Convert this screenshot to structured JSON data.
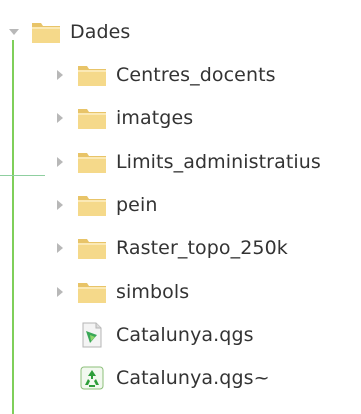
{
  "colors": {
    "tree_guide": "#7fcf5a",
    "folder_body": "#f5d98a",
    "folder_tab": "#e8c468",
    "expander": "#b8b8b8",
    "text": "#333333",
    "qgs_icon": "#3aa757",
    "recycle_icon": "#2e9e3a"
  },
  "tree": {
    "root": {
      "label": "Dades",
      "expanded": true,
      "icon": "folder-open-icon"
    },
    "children": [
      {
        "label": "Centres_docents",
        "type": "folder",
        "icon": "folder-icon"
      },
      {
        "label": "imatges",
        "type": "folder",
        "icon": "folder-icon"
      },
      {
        "label": "Limits_administratius",
        "type": "folder",
        "icon": "folder-icon"
      },
      {
        "label": "pein",
        "type": "folder",
        "icon": "folder-icon"
      },
      {
        "label": "Raster_topo_250k",
        "type": "folder",
        "icon": "folder-icon"
      },
      {
        "label": "simbols",
        "type": "folder",
        "icon": "folder-icon"
      },
      {
        "label": "Catalunya.qgs",
        "type": "file",
        "icon": "qgs-file-icon"
      },
      {
        "label": "Catalunya.qgs~",
        "type": "file",
        "icon": "backup-file-icon"
      }
    ]
  }
}
